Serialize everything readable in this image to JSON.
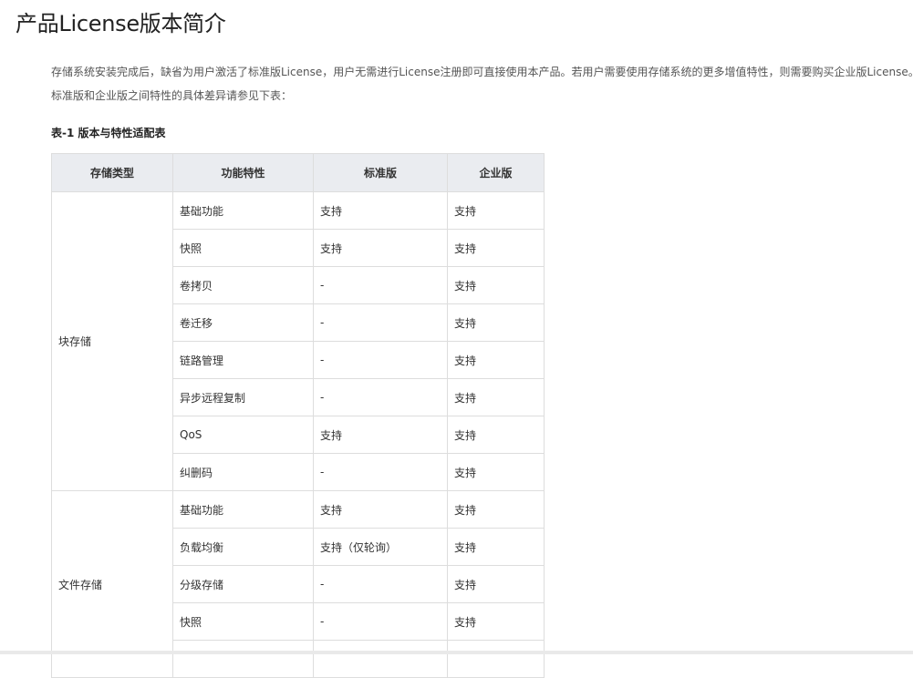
{
  "page": {
    "title": "产品License版本简介",
    "intro_line1": "存储系统安装完成后，缺省为用户激活了标准版License，用户无需进行License注册即可直接使用本产品。若用户需要使用存储系统的更多增值特性，则需要购买企业版License。",
    "intro_line2": "标准版和企业版之间特性的具体差异请参见下表："
  },
  "table": {
    "caption": "表-1 版本与特性适配表",
    "headers": [
      "存储类型",
      "功能特性",
      "标准版",
      "企业版"
    ],
    "groups": [
      {
        "type": "块存储",
        "rows": [
          {
            "feature": "基础功能",
            "standard": "支持",
            "enterprise": "支持"
          },
          {
            "feature": "快照",
            "standard": "支持",
            "enterprise": "支持"
          },
          {
            "feature": "卷拷贝",
            "standard": "-",
            "enterprise": "支持"
          },
          {
            "feature": "卷迁移",
            "standard": "-",
            "enterprise": "支持"
          },
          {
            "feature": "链路管理",
            "standard": "-",
            "enterprise": "支持"
          },
          {
            "feature": "异步远程复制",
            "standard": "-",
            "enterprise": "支持"
          },
          {
            "feature": "QoS",
            "standard": "支持",
            "enterprise": "支持"
          },
          {
            "feature": "纠删码",
            "standard": "-",
            "enterprise": "支持"
          }
        ]
      },
      {
        "type": "文件存储",
        "rows": [
          {
            "feature": "基础功能",
            "standard": "支持",
            "enterprise": "支持"
          },
          {
            "feature": "负载均衡",
            "standard": "支持（仅轮询）",
            "enterprise": "支持"
          },
          {
            "feature": "分级存储",
            "standard": "-",
            "enterprise": "支持"
          },
          {
            "feature": "快照",
            "standard": "-",
            "enterprise": "支持"
          },
          {
            "feature": "",
            "standard": "",
            "enterprise": ""
          }
        ]
      }
    ]
  }
}
